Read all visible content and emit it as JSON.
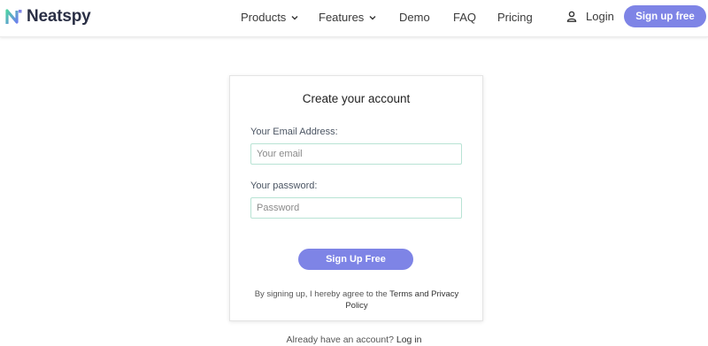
{
  "brand": {
    "name": "Neatspy",
    "accent": "#7e84e6"
  },
  "nav": {
    "items": [
      {
        "label": "Products",
        "dropdown": true
      },
      {
        "label": "Features",
        "dropdown": true
      },
      {
        "label": "Demo",
        "dropdown": false
      },
      {
        "label": "FAQ",
        "dropdown": false
      },
      {
        "label": "Pricing",
        "dropdown": false
      }
    ],
    "login_label": "Login",
    "signup_label": "Sign up free"
  },
  "form": {
    "title": "Create your account",
    "email_label": "Your Email Address:",
    "email_placeholder": "Your email",
    "password_label": "Your password:",
    "password_placeholder": "Password",
    "submit_label": "Sign Up Free",
    "terms_prefix": "By signing up, I hereby agree to the ",
    "terms_link": "Terms and Privacy Policy"
  },
  "footer": {
    "already_text": "Already have an account? ",
    "login_link": "Log in"
  }
}
